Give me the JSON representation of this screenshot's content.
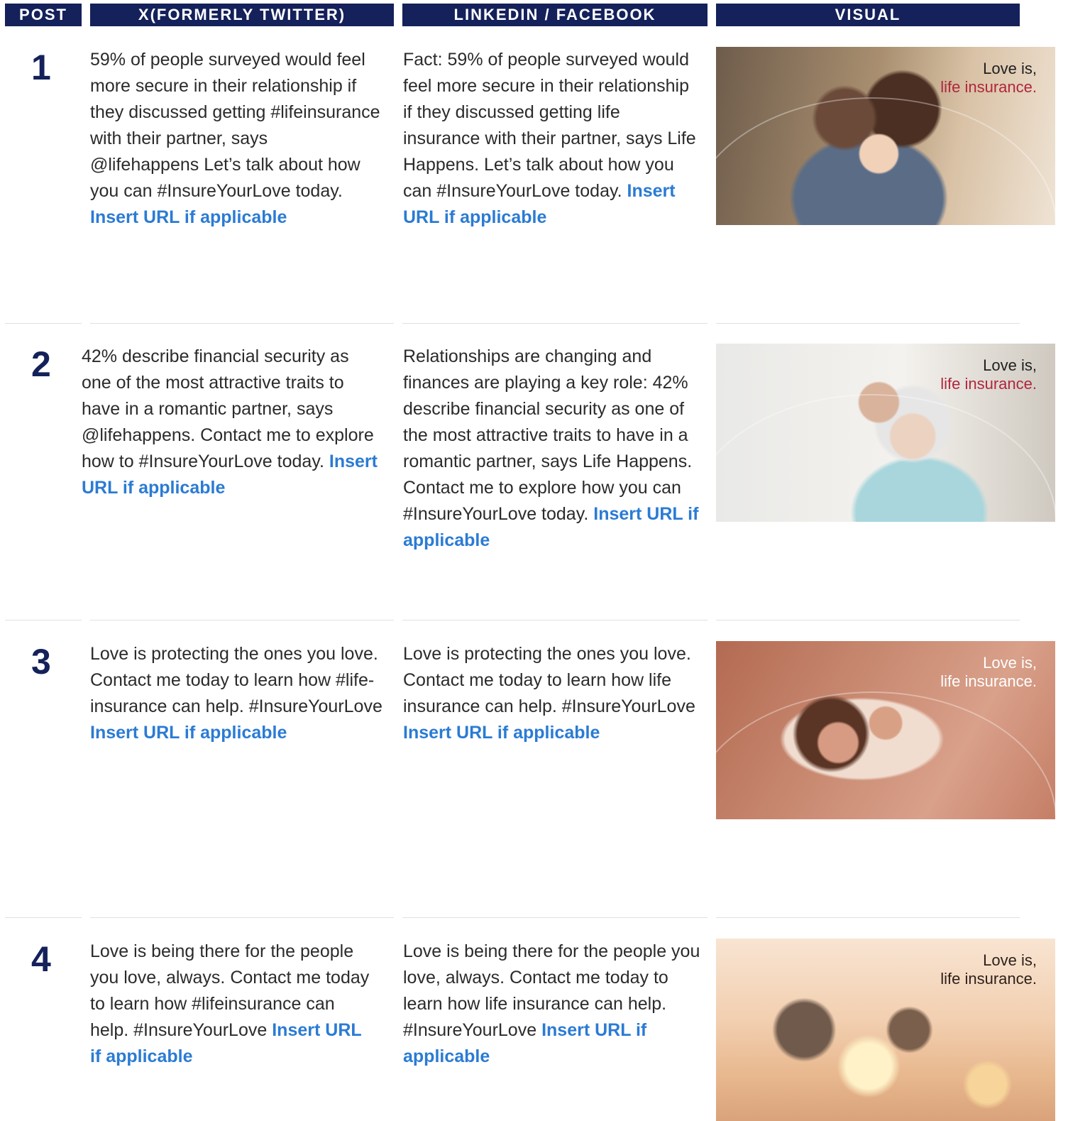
{
  "headers": {
    "post": "POST",
    "x": "X(FORMERLY TWITTER)",
    "linkedin": "LINKEDIN / FACEBOOK",
    "visual": "VISUAL"
  },
  "posts": [
    {
      "number": "1",
      "x_text": "59% of people surveyed would feel more secure in their relationship if they discussed getting #lifeinsurance with their partner, says @lifehappens Let’s talk about how you can #InsureYourLove today.",
      "x_link": "Insert URL if applicable",
      "li_text": "Fact: 59% of people surveyed would feel more secure in their relationship if they discussed getting life insurance with their partner, says Life Happens. Let’s talk about how you can #InsureYourLove today.",
      "li_link": "Insert URL if applicable",
      "visual_line1": "Love is,",
      "visual_line2": "life insurance."
    },
    {
      "number": "2",
      "x_text": "42% describe financial security as one of the most attractive traits to have in a romantic partner, says @lifehappens. Contact me to explore how to #InsureYourLove today.",
      "x_link": "Insert URL if applicable",
      "li_text": "Relationships are changing and finances are playing a key role: 42% describe financial security as one of the most attractive traits to have in a romantic partner, says Life Happens. Contact me to explore how you can #InsureYourLove today.",
      "li_link": "Insert URL if applicable",
      "visual_line1": "Love is,",
      "visual_line2": "life insurance."
    },
    {
      "number": "3",
      "x_text": "Love is protecting the ones you love. Contact me today to learn how #life-insurance can help. #InsureYourLove",
      "x_link": "Insert URL if applicable",
      "li_text": "Love is protecting the ones you love. Contact me today to learn how life insurance can help. #InsureYourLove",
      "li_link": "Insert URL if applicable",
      "visual_line1": "Love is,",
      "visual_line2": "life insurance."
    },
    {
      "number": "4",
      "x_text": "Love is being there for the people you love, always. Contact me today to learn how #lifeinsurance can help. #InsureYourLove",
      "x_link": "Insert URL if applicable",
      "li_text": "Love is being there for the people you love, always. Contact me today to learn how life insurance can help. #InsureYourLove",
      "li_link": "Insert URL if applicable",
      "visual_line1": "Love is,",
      "visual_line2": "life insurance."
    }
  ]
}
